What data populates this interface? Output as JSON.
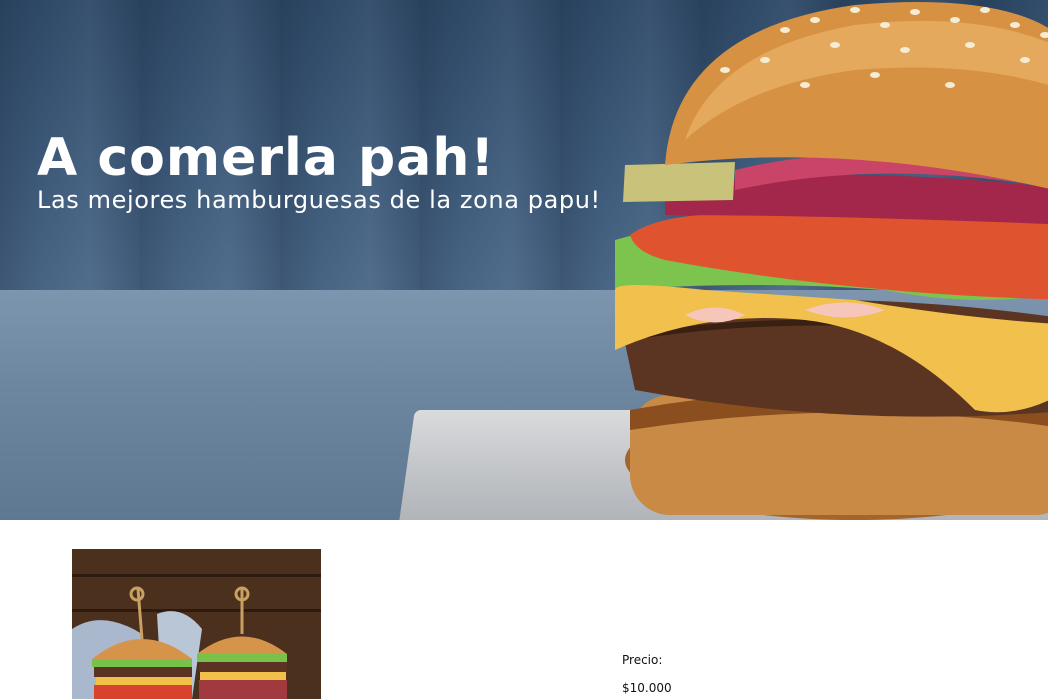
{
  "hero": {
    "title": "A comerla pah!",
    "subtitle": "Las mejores hamburguesas de la zona papu!",
    "image_icon": "burger-icon"
  },
  "product": {
    "image_icon": "double-burger-icon",
    "price_label": "Precio:",
    "price_value": "$10.000"
  },
  "colors": {
    "text_on_hero": "#ffffff",
    "page_background": "#ffffff",
    "body_text": "#111111"
  }
}
